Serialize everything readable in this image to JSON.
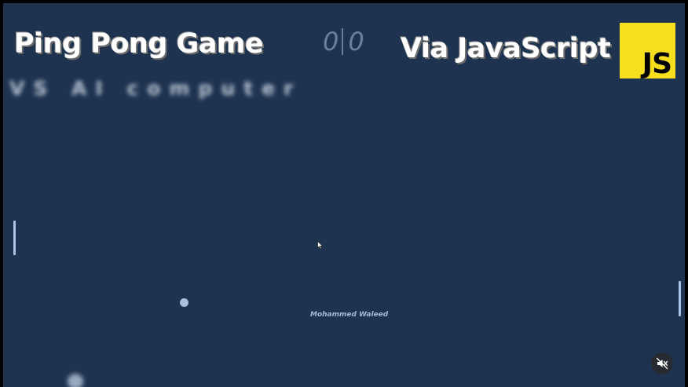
{
  "header": {
    "title": "Ping Pong Game",
    "subtitle": "VS AI computer",
    "right_title": "Via JavaScript",
    "logo_text": "JS"
  },
  "score": {
    "player": "0",
    "computer": "0"
  },
  "watermark": "Mohammed Waleed",
  "colors": {
    "background": "#1d3350",
    "paddle": "#a9c4e6",
    "ball": "#a9c1de",
    "logo_bg": "#f7df1e"
  },
  "icons": {
    "mute": "speaker-muted-icon",
    "cursor": "mouse-pointer-icon"
  }
}
